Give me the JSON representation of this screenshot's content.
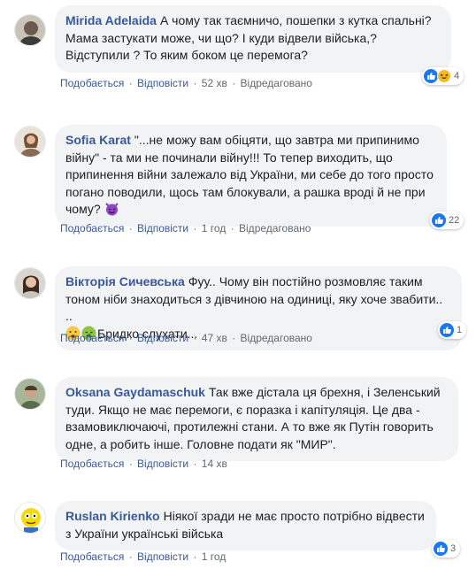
{
  "labels": {
    "like": "Подобається",
    "reply": "Відповісти",
    "edited": "Відредаговано"
  },
  "comments": [
    {
      "author": "Mirida Adelaida",
      "text": "А чому так таємничо, пошепки з кутка спальні? Мама застукати може, чи що? І куди відвели війська,? Відступили ? То яким боком це перемога?",
      "time": "52 хв",
      "edited": true,
      "reactions": {
        "icons": [
          "like-icon",
          "haha-icon"
        ],
        "count": "4"
      }
    },
    {
      "author": "Sofia Karat",
      "text": "\"...не можу вам обіцяти, що завтра ми припинимо війну\" - та ми не починали війну!!! То тепер виходить, що припинення війни залежало від України, ми себе до того просто погано поводили, щось там блокували, а рашка вроді й не при чому?",
      "emoji_after": [
        "devil-emoji-icon"
      ],
      "time": "1 год",
      "edited": true,
      "reactions": {
        "icons": [
          "like-icon"
        ],
        "count": "22"
      }
    },
    {
      "author": "Вікторія Сичевська",
      "text": "Фуу.. Чому він постійно розмовляє таким тоном ніби знаходиться з дівчиною на одиниці, яку хоче звабити.. ..",
      "emoji_before_tail": [
        "nauseated-emoji-icon",
        "sick-emoji-icon"
      ],
      "text_tail": "Бридко слухати...",
      "time": "47 хв",
      "edited": true,
      "reactions": {
        "icons": [
          "like-icon"
        ],
        "count": "1"
      }
    },
    {
      "author": "Oksana Gaydamaschuk",
      "text": "Так вже дістала ця брехня, і Зеленський туди. Якщо не має перемоги, є поразка і капітуляція. Це два - взамовиключаючі, протилежні стани. А то вже як Путін говорить одне, а робить інше. Головне подати як \"МИР\".",
      "time": "14 хв",
      "edited": false
    },
    {
      "author": "Ruslan Kirienko",
      "text": "Ніякої зради не має просто потрібно відвести з України українські війська",
      "time": "1 год",
      "edited": false,
      "reactions": {
        "icons": [
          "like-icon"
        ],
        "count": "3"
      }
    }
  ],
  "colors": {
    "author_link": "#385898",
    "bubble_bg": "#f2f3f5",
    "meta": "#606770",
    "like_blue": "#1877f2"
  }
}
